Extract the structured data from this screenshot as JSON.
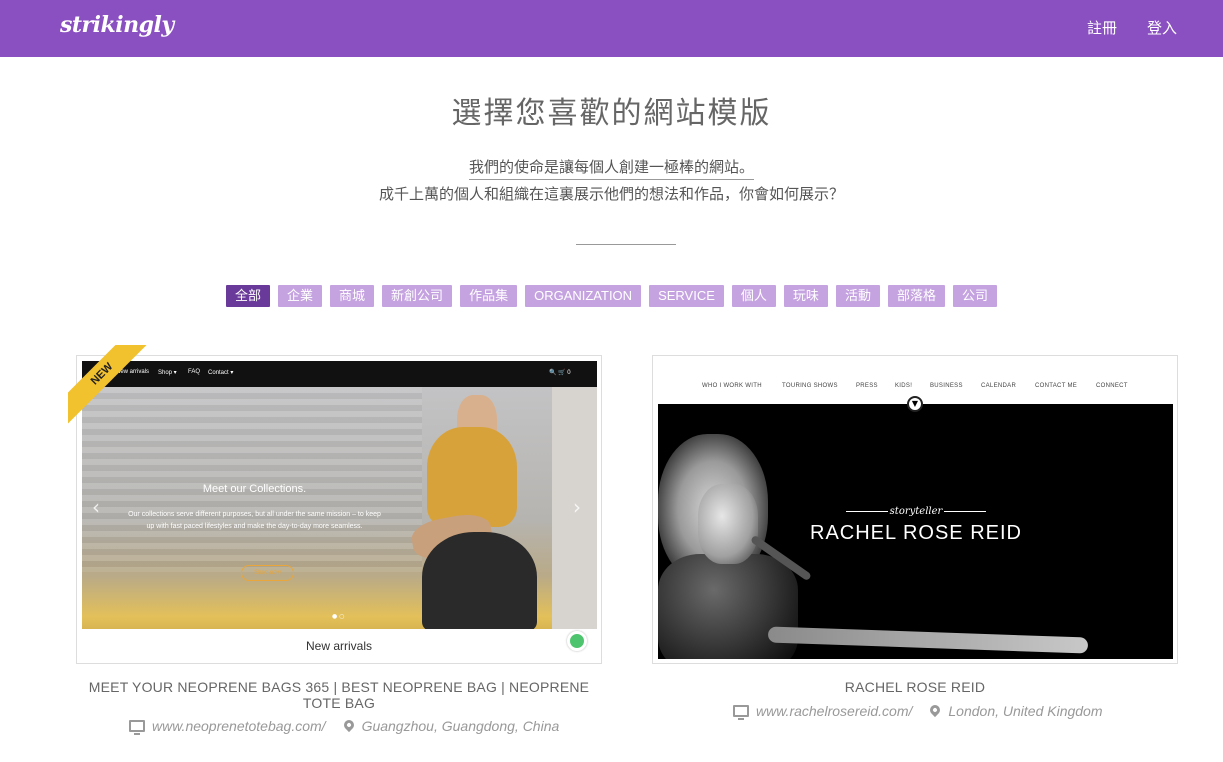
{
  "header": {
    "logo": "strikingly",
    "signup": "註冊",
    "login": "登入"
  },
  "main": {
    "title": "選擇您喜歡的網站模版",
    "mission": "我們的使命是讓每個人創建一極棒的網站。",
    "sub_mission": "成千上萬的個人和組織在這裏展示他們的想法和作品，你會如何展示？"
  },
  "filters": [
    {
      "label": "全部",
      "active": true
    },
    {
      "label": "企業",
      "active": false
    },
    {
      "label": "商城",
      "active": false
    },
    {
      "label": "新創公司",
      "active": false
    },
    {
      "label": "作品集",
      "active": false
    },
    {
      "label": "ORGANIZATION",
      "active": false
    },
    {
      "label": "SERVICE",
      "active": false
    },
    {
      "label": "個人",
      "active": false
    },
    {
      "label": "玩味",
      "active": false
    },
    {
      "label": "活動",
      "active": false
    },
    {
      "label": "部落格",
      "active": false
    },
    {
      "label": "公司",
      "active": false
    }
  ],
  "templates": [
    {
      "badge": "NEW",
      "preview": {
        "nav": [
          "New arrivals",
          "Shop ▾",
          "FAQ",
          "Contact ▾"
        ],
        "nav_right": "🔍  🛒 0",
        "hero_title": "Meet our Collections.",
        "hero_desc": "Our collections serve different purposes, but all under the same mission – to keep up with fast paced lifestyles and make the day-to-day more seamless.",
        "hero_button": "Shop now",
        "caption": "New arrivals"
      },
      "title": "MEET YOUR NEOPRENE BAGS 365 | BEST NEOPRENE BAG | NEOPRENE TOTE BAG",
      "url": "www.neoprenetotebag.com/",
      "location": "Guangzhou, Guangdong, China"
    },
    {
      "preview": {
        "nav": [
          "WHO I WORK WITH",
          "TOURING SHOWS",
          "PRESS",
          "KIDS!",
          "BUSINESS",
          "CALENDAR",
          "CONTACT ME",
          "CONNECT"
        ],
        "tagline": "storyteller",
        "hero_name": "RACHEL ROSE REID"
      },
      "title": "RACHEL ROSE REID",
      "url": "www.rachelrosereid.com/",
      "location": "London, United Kingdom"
    }
  ],
  "colors": {
    "brand": "#8a4fc0",
    "filter_active": "#6a3a9a",
    "filter_inactive": "#c5a3e0",
    "badge": "#f2c12e"
  }
}
